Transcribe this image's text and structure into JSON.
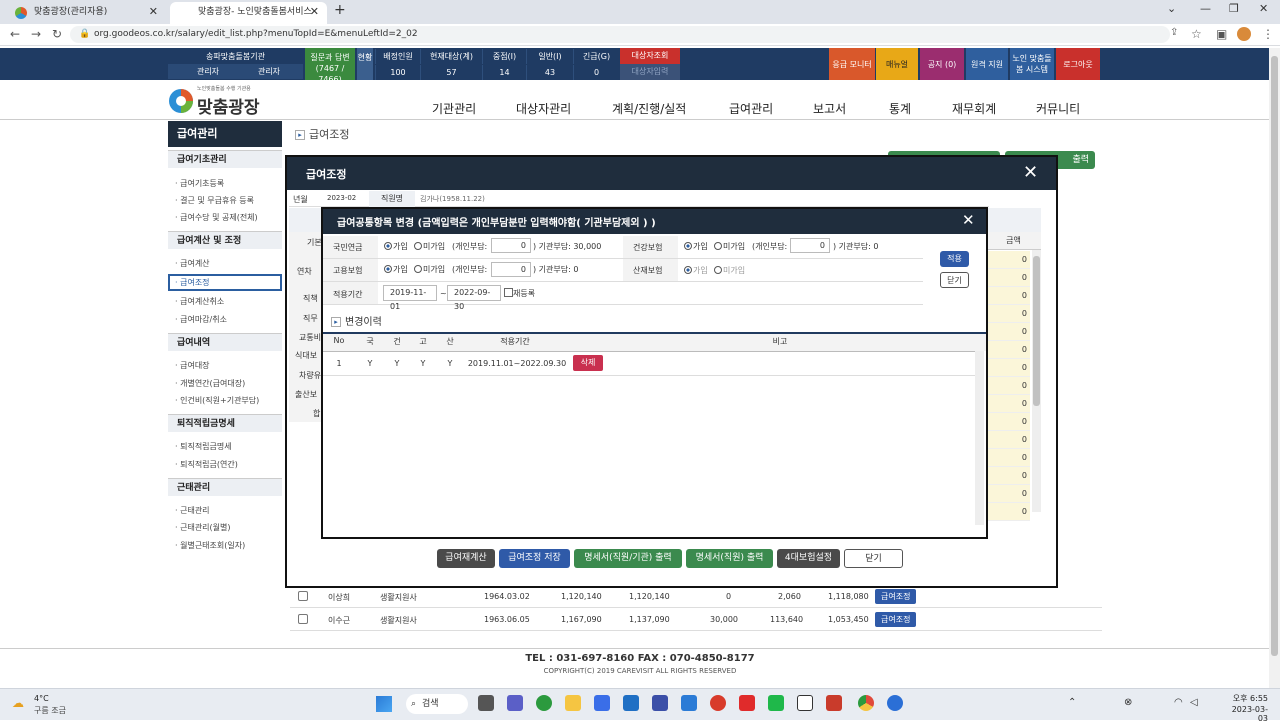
{
  "browser": {
    "tabs": [
      {
        "label": "맞춤광장(관리자용)"
      },
      {
        "label": "맞춤광장- 노인맞춤돌봄서비스"
      }
    ],
    "url": "org.goodeos.co.kr/salary/edit_list.php?menuTopId=E&menuLeftId=2_02"
  },
  "sitebar": {
    "org_label": "송파맞춤돌봄기관",
    "admin1": "관리자",
    "admin2": "관리자",
    "qna": "질문과 답변",
    "qna_count": "(7467 / 7466)",
    "hyeon": "현황",
    "stats": [
      {
        "label": "배정인원",
        "value": "100"
      },
      {
        "label": "현재대상(계)",
        "value": "57"
      },
      {
        "label": "중점(I)",
        "value": "14"
      },
      {
        "label": "일반(I)",
        "value": "43"
      },
      {
        "label": "긴급(G)",
        "value": "0"
      }
    ],
    "target_lookup": "대상자조회",
    "target_input": "대상자입력",
    "buttons": [
      {
        "label": "응급 모니터",
        "color": "#d9582b"
      },
      {
        "label": "매뉴얼",
        "color": "#e8a817"
      },
      {
        "label": "공지 (0)",
        "color": "#9b2d6f"
      },
      {
        "label": "원격 지원",
        "color": "#2f5f9e"
      },
      {
        "label": "노인 맞춤돌봄 시스템",
        "color": "#2f5f9e"
      },
      {
        "label": "로그아웃",
        "color": "#c9302c"
      }
    ]
  },
  "logo": {
    "sub": "노인맞춤돌봄 수행 기관용",
    "title": "맞춤광장"
  },
  "nav": [
    "기관관리",
    "대상자관리",
    "계획/진행/실적",
    "급여관리",
    "보고서",
    "통계",
    "재무회계",
    "커뮤니티"
  ],
  "leftmenu": {
    "title": "급여관리",
    "sections": [
      {
        "title": "급여기초관리",
        "items": [
          "급여기초등록",
          "결근 및 무급휴유 등록",
          "급여수당 및 공제(전체)"
        ]
      },
      {
        "title": "급여계산 및 조정",
        "items": [
          "급여계산",
          "급여조정",
          "급여계산취소",
          "급여마감/취소"
        ]
      },
      {
        "title": "급여내역",
        "items": [
          "급여대장",
          "개별연간(급여대장)",
          "인건비(직원+기관부담)"
        ]
      },
      {
        "title": "퇴직적립금명세",
        "items": [
          "퇴직적립금명세",
          "퇴직적립금(연간)"
        ]
      },
      {
        "title": "근태관리",
        "items": [
          "근태관리",
          "근태관리(월별)",
          "월별근태조회(일자)"
        ]
      }
    ]
  },
  "page": {
    "title": "급여조정",
    "print_btn": "출력"
  },
  "bg_rows": [
    {
      "name": "이상희",
      "role": "생활지원사",
      "birth": "1964.03.02",
      "a": "1,120,140",
      "b": "1,120,140",
      "c": "0",
      "d": "2,060",
      "e": "1,118,080",
      "btn": "급여조정"
    },
    {
      "name": "이수근",
      "role": "생활지원사",
      "birth": "1963.06.05",
      "a": "1,167,090",
      "b": "1,137,090",
      "c": "30,000",
      "d": "113,640",
      "e": "1,053,450",
      "btn": "급여조정"
    }
  ],
  "outer_modal": {
    "title": "급여조정",
    "year_label": "년월",
    "year_value": "2023-02",
    "staff_label": "직원명",
    "staff_value": "김가나(1958.11.22)",
    "side_labels": [
      "기본",
      "연차",
      "직책",
      "직무",
      "교통비",
      "식대보",
      "차량유",
      "출산보",
      "합"
    ],
    "amount_header": "금액",
    "amounts": [
      "0",
      "0",
      "0",
      "0",
      "0",
      "0",
      "0",
      "0",
      "0",
      "0",
      "0",
      "0",
      "0",
      "0",
      "0"
    ],
    "buttons": [
      {
        "label": "급여재계산",
        "color": "#4a4a4a"
      },
      {
        "label": "급여조정 저장",
        "color": "#2f5aa8"
      },
      {
        "label": "명세서(직원/기관) 출력",
        "color": "#3b8a4e"
      },
      {
        "label": "명세서(직원) 출력",
        "color": "#3b8a4e"
      },
      {
        "label": "4대보험설정",
        "color": "#4a4a4a"
      },
      {
        "label": "닫기",
        "color": "#ffffff"
      }
    ]
  },
  "inner_modal": {
    "title": "급여공통항목 변경 (금액입력은 개인부담분만 입력해야함( 기관부담제외 ) )",
    "join": "가입",
    "nojoin": "미가입",
    "personal_label": "(개인부담:",
    "pension": {
      "label": "국민연금",
      "personal": "0",
      "org": ") 기관부담: 30,000"
    },
    "health": {
      "label": "건강보험",
      "personal": "0",
      "org": ") 기관부담: 0"
    },
    "employ": {
      "label": "고용보험",
      "personal": "0",
      "org": ") 기관부담: 0"
    },
    "accident": {
      "label": "산재보험"
    },
    "period_label": "적용기간",
    "period_from": "2019-11-01",
    "period_tilde": "~",
    "period_to": "2022-09-30",
    "reregister": "재등록",
    "apply_btn": "적용",
    "close_btn": "닫기",
    "history_title": "변경이력",
    "history_headers": [
      "No",
      "국",
      "건",
      "고",
      "산",
      "적용기간",
      "비고"
    ],
    "history_rows": [
      {
        "no": "1",
        "k": "Y",
        "g": "Y",
        "go": "Y",
        "s": "Y",
        "period": "2019.11.01~2022.09.30",
        "del": "삭제"
      }
    ]
  },
  "footer": {
    "contact": "TEL : 031-697-8160    FAX : 070-4850-8177",
    "copyright": "COPYRIGHT(C) 2019 CAREVISIT ALL RIGHTS RESERVED"
  },
  "taskbar": {
    "temp": "4°C",
    "weather": "구름 조금",
    "search": "검색",
    "time": "오후 6:55",
    "date": "2023-03-03"
  }
}
